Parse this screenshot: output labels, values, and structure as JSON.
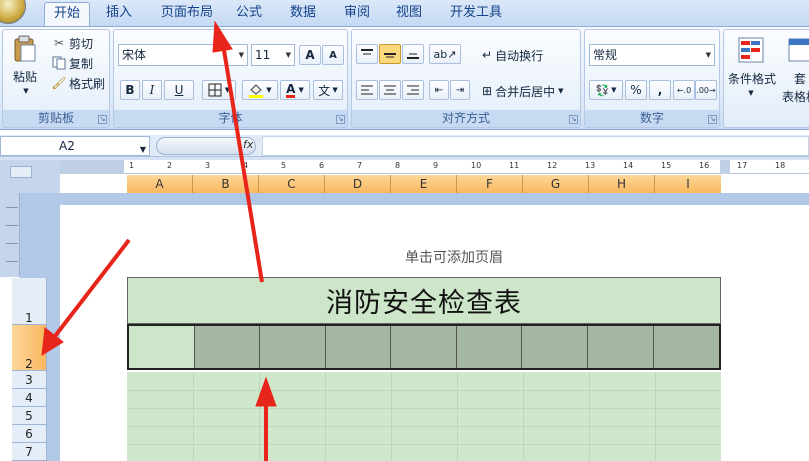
{
  "tabs": [
    "开始",
    "插入",
    "页面布局",
    "公式",
    "数据",
    "审阅",
    "视图",
    "开发工具"
  ],
  "active_tab": "开始",
  "clipboard": {
    "paste": "粘贴",
    "cut": "剪切",
    "copy": "复制",
    "format_painter": "格式刷",
    "label": "剪贴板"
  },
  "font": {
    "name": "宋体",
    "size": "11",
    "grow": "A",
    "shrink": "A",
    "bold": "B",
    "italic": "I",
    "underline": "U",
    "color_letter": "A",
    "wen": "文",
    "label": "字体"
  },
  "alignment": {
    "wrap": "自动换行",
    "merge": "合并后居中",
    "label": "对齐方式"
  },
  "number": {
    "format": "常规",
    "percent": "%",
    "comma": ",",
    "label": "数字"
  },
  "styles": {
    "conditional": "条件格式",
    "table_partial": "套",
    "table_partial2": "表格格"
  },
  "formula_bar": {
    "namebox": "A2",
    "fx": "fx"
  },
  "ruler": {
    "numbers": [
      "1",
      "2",
      "3",
      "4",
      "5",
      "6",
      "7",
      "8",
      "9",
      "10",
      "11",
      "12",
      "13",
      "14",
      "15",
      "16",
      "17",
      "18"
    ]
  },
  "columns": [
    "A",
    "B",
    "C",
    "D",
    "E",
    "F",
    "G",
    "H",
    "I"
  ],
  "rows": [
    "1",
    "2",
    "3",
    "4",
    "5",
    "6",
    "7"
  ],
  "selected_row": "2",
  "page_header_hint": "单击可添加页眉",
  "sheet_title": "消防安全检查表",
  "colors": {
    "title_fill": "#cde5c8",
    "row2_fill": "#a5b8a4",
    "annotation_arrow": "#e8251a"
  }
}
